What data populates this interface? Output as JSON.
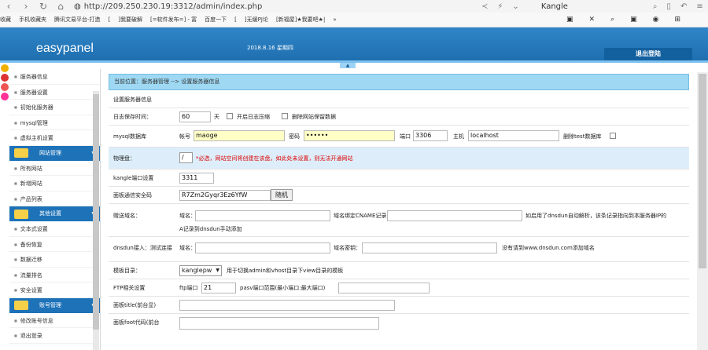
{
  "browser": {
    "url": "http://209.250.230.19:3312/admin/index.php",
    "search_text": "Kangle"
  },
  "bookmarks": [
    "收藏",
    "手机收藏夹",
    "腾讯文易平台-打造",
    "[",
    "]我要破解",
    "[=软件发布=] - 富",
    "百度一下",
    "[",
    "]无缓PJ论",
    "[新福屋]★我要吧★|",
    "»"
  ],
  "header": {
    "logo": "easypanel",
    "date": "2018.8.16 星期四",
    "logout": "退出登陆"
  },
  "sidebar": {
    "group1": [
      "服务器信息",
      "服务器设置",
      "初始化服务器",
      "mysql管理",
      "虚拟主机设置"
    ],
    "section2": "网站管理",
    "group2": [
      "所有网站",
      "新增网站",
      "产品列表"
    ],
    "section3": "其他设置",
    "group3": [
      "文本式设置",
      "备份恢复",
      "数据迁移",
      "流量排名",
      "安全设置"
    ],
    "section4": "账号管理",
    "group4": [
      "修改账号信息",
      "退出登录"
    ]
  },
  "breadcrumb": "当前位置：服务器管理 --> 设置服务器信息",
  "form": {
    "section_title": "设置服务器信息",
    "log": {
      "label": "日志保存时间：",
      "value": "60",
      "unit": "天",
      "compress": "开启日志压缩",
      "delete_data": "删除网站保留数据"
    },
    "mysql": {
      "label": "mysql数据库",
      "account_label": "帐号",
      "account": "maoge",
      "pwd_label": "密码",
      "pwd": "••••••",
      "port_label": "端口",
      "port": "3306",
      "host_label": "主机",
      "host": "localhost",
      "del_test": "删除test数据库"
    },
    "disk": {
      "label": "物理盘：",
      "value": "/",
      "note": "*必选，网站空间将创建在该盘，如此处未设置，则无法开通网站"
    },
    "kport": {
      "label": "kangle端口设置",
      "value": "3311"
    },
    "secret": {
      "label": "面板通信安全码",
      "value": "R7Zm2Gyqr3Ez6YfW",
      "button": "随机"
    },
    "bind": {
      "label": "赠送域名：",
      "domain": "域名：",
      "cname": "域名绑定CNAME记录",
      "note": "如启用了dnsdun自动解析，该条记录指向到本服务器IP的",
      "note2": "A记录到dnsdun手动添加"
    },
    "dnsdun": {
      "label": "dnsdun接入：测试连接",
      "domain": "域名：",
      "key": "域名密钥：",
      "note": "没有请到www.dnsdun.com添加域名"
    },
    "tpl": {
      "label": "模板目录：",
      "value": "kanglepw",
      "note": "用于切换admin和vhost目录下view目录的模板"
    },
    "ftp": {
      "label": "FTP相关设置",
      "port_label": "ftp端口",
      "port": "21",
      "pasv": "pasv端口范围(最小端口:最大端口)"
    },
    "title": {
      "label": "面板title(前台显)"
    },
    "foot": {
      "label": "面板foot代码(前台"
    }
  }
}
